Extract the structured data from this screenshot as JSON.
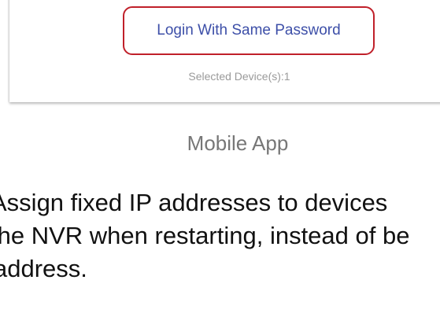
{
  "mobile_app_screen": {
    "login_button_label": "Login With Same Password",
    "selected_devices_text": "Selected Device(s):1"
  },
  "caption": "Mobile App",
  "body_text": {
    "lines": [
      "Assign fixed IP addresses to devices",
      "the NVR when restarting, instead of be",
      "address."
    ]
  },
  "colors": {
    "button_border": "#c0202a",
    "button_text": "#3d4fa8",
    "muted_text": "#9a9a9a",
    "caption_text": "#777777"
  }
}
